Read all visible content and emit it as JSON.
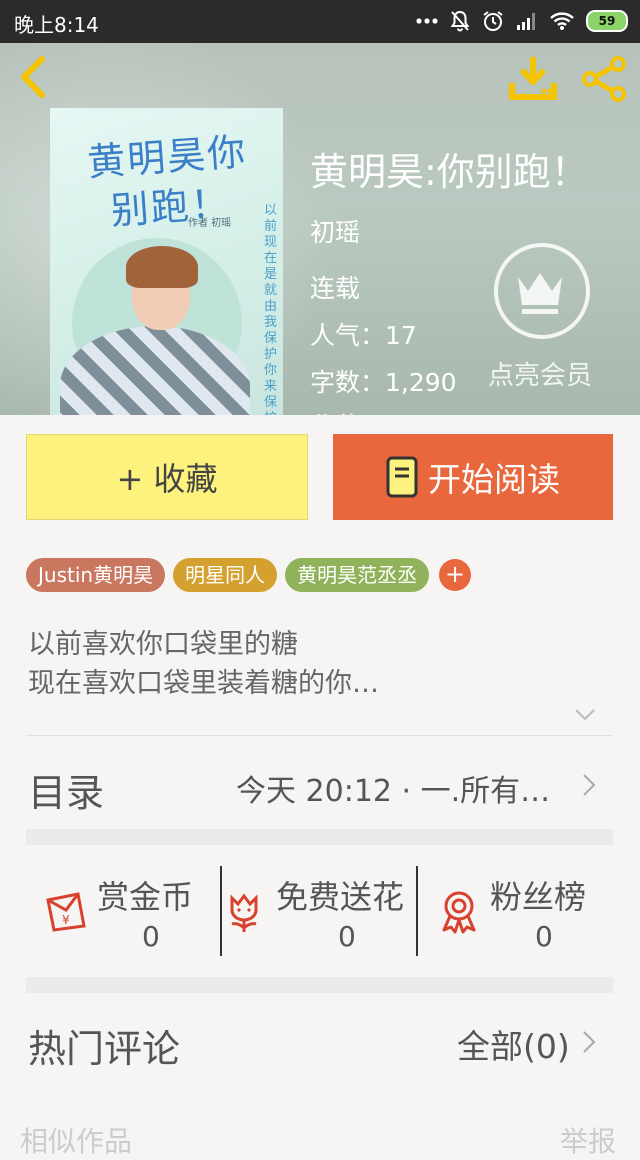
{
  "status_bar": {
    "time": "晚上8:14",
    "battery": "59"
  },
  "book": {
    "title": "黄明昊:你别跑！",
    "author": "初瑶",
    "status": "连载",
    "popularity": "人气：17",
    "word_count": "字数：1,290",
    "extra_cut": "收藏"
  },
  "cover": {
    "title": "黄明昊你别跑！",
    "author_line": "作者 初瑶",
    "poem": "以前现在是就由我保护你来保护我"
  },
  "vip": {
    "label": "点亮会员"
  },
  "actions": {
    "collect": "+ 收藏",
    "read": "开始阅读"
  },
  "tags": [
    {
      "label": "Justin黄明昊",
      "color": "#c9775e"
    },
    {
      "label": "明星同人",
      "color": "#d4a030"
    },
    {
      "label": "黄明昊范丞丞",
      "color": "#8fb25a"
    }
  ],
  "tag_add": "+",
  "synopsis": {
    "line1": "以前喜欢你口袋里的糖",
    "line2": "现在喜欢口袋里装着糖的你…"
  },
  "toc": {
    "title": "目录",
    "latest": "今天 20:12 · 一.所有…"
  },
  "stats": [
    {
      "label": "赏金币",
      "value": "0",
      "icon": "red-envelope-icon"
    },
    {
      "label": "免费送花",
      "value": "0",
      "icon": "flower-icon"
    },
    {
      "label": "粉丝榜",
      "value": "0",
      "icon": "medal-icon"
    }
  ],
  "comments": {
    "title": "热门评论",
    "all": "全部(0)"
  },
  "bottom_cut": {
    "left": "相似作品",
    "right": "举报"
  },
  "colors": {
    "accent_orange": "#e9673c",
    "collect_yellow": "#fdf27e",
    "icon_gold": "#f4c400",
    "icon_red": "#d9412f"
  }
}
